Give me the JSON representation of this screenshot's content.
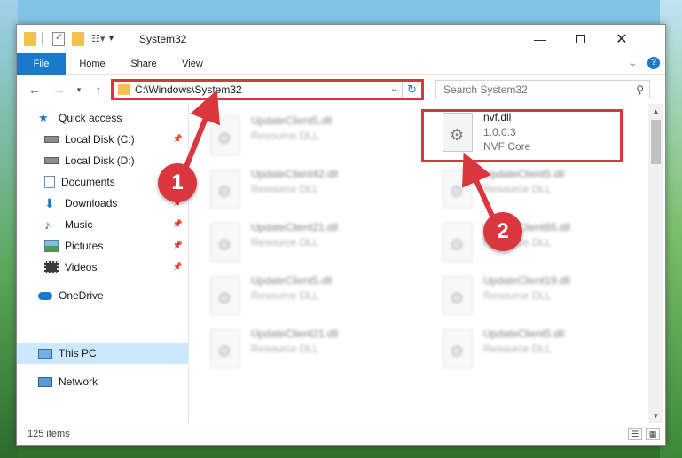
{
  "window": {
    "title": "System32"
  },
  "ribbon": {
    "tabs": [
      "File",
      "Home",
      "Share",
      "View"
    ]
  },
  "address": {
    "path": "C:\\Windows\\System32"
  },
  "search": {
    "placeholder": "Search System32"
  },
  "sidebar": {
    "items": [
      {
        "label": "Quick access",
        "icon": "star-icon"
      },
      {
        "label": "Local Disk (C:)",
        "icon": "drive-icon",
        "pinned": true
      },
      {
        "label": "Local Disk (D:)",
        "icon": "drive-icon"
      },
      {
        "label": "Documents",
        "icon": "documents-icon"
      },
      {
        "label": "Downloads",
        "icon": "download-arrow-icon",
        "pinned": true
      },
      {
        "label": "Music",
        "icon": "music-note-icon",
        "pinned": true
      },
      {
        "label": "Pictures",
        "icon": "pictures-icon",
        "pinned": true
      },
      {
        "label": "Videos",
        "icon": "video-film-icon",
        "pinned": true
      },
      {
        "label": "OneDrive",
        "icon": "cloud-icon"
      },
      {
        "label": "This PC",
        "icon": "monitor-icon",
        "selected": true
      },
      {
        "label": "Network",
        "icon": "network-icon"
      }
    ]
  },
  "files": {
    "left": [
      {
        "name": "UpdateClient5.dll",
        "type": "Resource DLL"
      },
      {
        "name": "UpdateClient42.dll",
        "type": "Resource DLL"
      },
      {
        "name": "UpdateClient21.dll",
        "type": "Resource DLL"
      },
      {
        "name": "UpdateClient5.dll",
        "type": "Resource DLL"
      },
      {
        "name": "UpdateClient21.dll",
        "type": "Resource DLL"
      }
    ],
    "right": [
      {
        "name": "nvf.dll",
        "type": "1.0.0.3",
        "desc": "NVF Core"
      },
      {
        "name": "UpdateClient5.dll",
        "type": "Resource DLL"
      },
      {
        "name": "UpdateClient65.dll",
        "type": "Resource DLL"
      },
      {
        "name": "UpdateClient19.dll",
        "type": "Resource DLL"
      },
      {
        "name": "UpdateClient5.dll",
        "type": "Resource DLL"
      }
    ]
  },
  "status": {
    "count": "125 items"
  },
  "annotations": {
    "marker1": "1",
    "marker2": "2"
  },
  "colors": {
    "accent": "#1979ca",
    "annotation_red": "#d9363e",
    "selection": "#cce8ff"
  }
}
